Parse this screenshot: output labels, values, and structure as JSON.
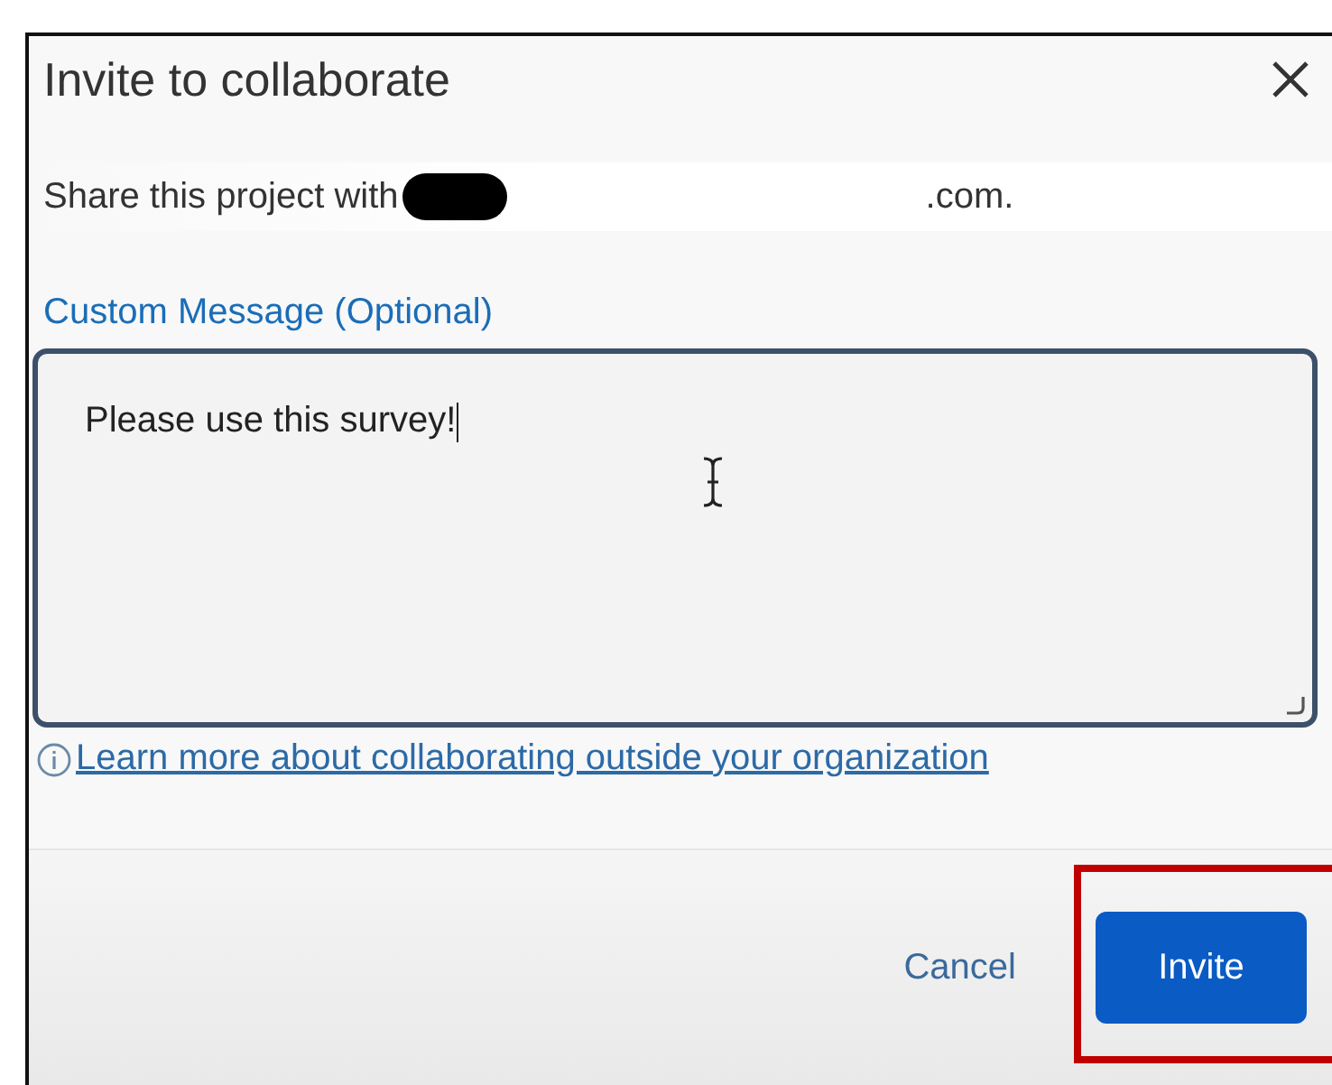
{
  "dialog": {
    "title": "Invite to collaborate",
    "share_prefix": "Share this project with",
    "share_suffix": ".com.",
    "message_label": "Custom Message (Optional)",
    "message_value": "Please use this survey!",
    "learn_more_link": "Learn more about collaborating outside your organization",
    "buttons": [
      {
        "label": "Cancel",
        "kind": "secondary"
      },
      {
        "label": "Invite",
        "kind": "primary",
        "highlighted": true
      }
    ]
  }
}
